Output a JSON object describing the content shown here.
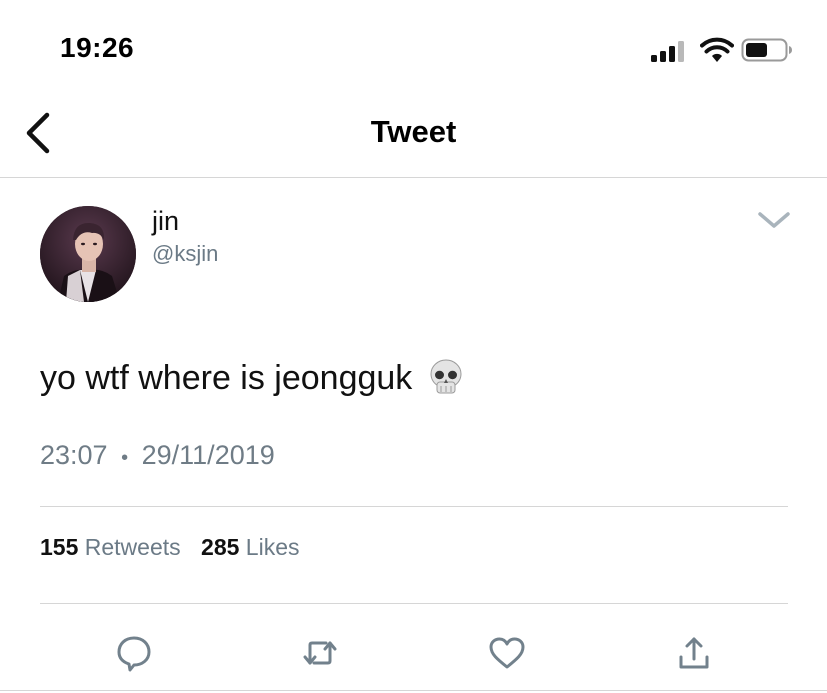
{
  "status_bar": {
    "time": "19:26"
  },
  "nav": {
    "title": "Tweet"
  },
  "tweet": {
    "author_name": "jin",
    "author_handle": "@ksjin",
    "text": "yo wtf where is jeongguk",
    "emoji": "skull",
    "time": "23:07",
    "separator": "•",
    "date": "29/11/2019",
    "retweets_count": "155",
    "retweets_label": "Retweets",
    "likes_count": "285",
    "likes_label": "Likes"
  },
  "icons": {
    "back": "chevron-left-icon",
    "more": "chevron-down-icon",
    "reply": "reply-icon",
    "retweet": "retweet-icon",
    "like": "heart-icon",
    "share": "share-icon"
  },
  "colors": {
    "text": "#111111",
    "secondary": "#6b7a86",
    "divider": "#d6d6d6"
  }
}
